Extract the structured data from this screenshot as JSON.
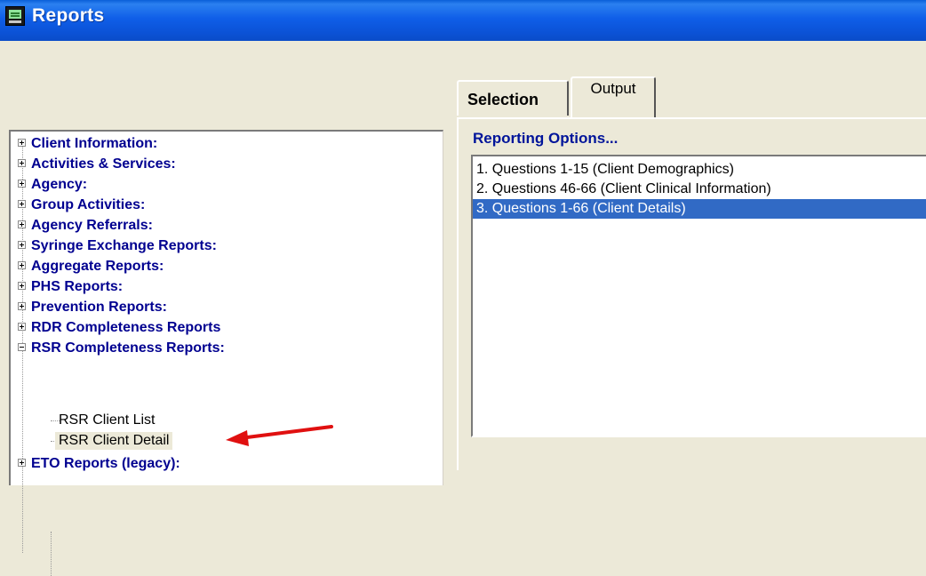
{
  "window": {
    "title": "Reports",
    "icon": "computer-monitor-icon"
  },
  "tabs": [
    {
      "label": "Selection",
      "active": false
    },
    {
      "label": "Output",
      "active": true
    }
  ],
  "tree": {
    "categories": [
      {
        "label": "Client Information:",
        "expanded": false
      },
      {
        "label": "Activities & Services:",
        "expanded": false
      },
      {
        "label": "Agency:",
        "expanded": false
      },
      {
        "label": "Group Activities:",
        "expanded": false
      },
      {
        "label": "Agency Referrals:",
        "expanded": false
      },
      {
        "label": "Syringe Exchange Reports:",
        "expanded": false
      },
      {
        "label": "Aggregate Reports:",
        "expanded": false
      },
      {
        "label": "PHS Reports:",
        "expanded": false
      },
      {
        "label": "Prevention Reports:",
        "expanded": false
      },
      {
        "label": "RDR Completeness Reports",
        "expanded": false
      },
      {
        "label": "RSR Completeness Reports:",
        "expanded": true
      },
      {
        "label": "ETO Reports (legacy):",
        "expanded": false
      }
    ],
    "rsr_children": [
      {
        "label": "RSR Client List",
        "selected": false
      },
      {
        "label": "RSR Client Detail",
        "selected": true
      }
    ]
  },
  "reporting_options": {
    "label": "Reporting Options...",
    "items": [
      "1. Questions 1-15  (Client Demographics)",
      "2. Questions 46-66  (Client Clinical Information)",
      "3. Questions 1-66  (Client Details)"
    ],
    "selected_index": 2
  },
  "annotation": {
    "icon": "red-arrow-icon",
    "color": "#e01010"
  },
  "colors": {
    "titlebar": "#0b52d6",
    "window_bg": "#ece9d8",
    "tree_text": "#000090",
    "selection_highlight": "#316ac5"
  }
}
